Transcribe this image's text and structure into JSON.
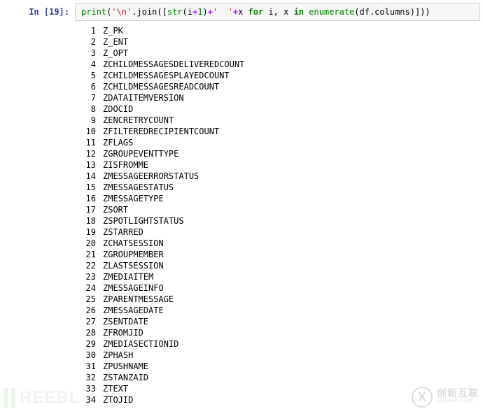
{
  "cell": {
    "prompt_label": "In [",
    "exec_count": "19",
    "prompt_close": "]:",
    "code": {
      "print": "print",
      "lp": "(",
      "str_newline": "'\\n'",
      "dot_join": ".join([",
      "str_fn": "str",
      "lp2": "(i",
      "plus1": "+",
      "one": "1",
      "rp2": ")",
      "plus2": "+",
      "str_space": "'  '",
      "plus3": "+",
      "var_x": "x ",
      "kw_for": "for",
      "iter_vars": " i, x ",
      "kw_in": "in",
      "sp": " ",
      "enumerate": "enumerate",
      "arg": "(df.columns)]))"
    }
  },
  "columns": [
    "Z_PK",
    "Z_ENT",
    "Z_OPT",
    "ZCHILDMESSAGESDELIVEREDCOUNT",
    "ZCHILDMESSAGESPLAYEDCOUNT",
    "ZCHILDMESSAGESREADCOUNT",
    "ZDATAITEMVERSION",
    "ZDOCID",
    "ZENCRETRYCOUNT",
    "ZFILTEREDRECIPIENTCOUNT",
    "ZFLAGS",
    "ZGROUPEVENTTYPE",
    "ZISFROMME",
    "ZMESSAGEERRORSTATUS",
    "ZMESSAGESTATUS",
    "ZMESSAGETYPE",
    "ZSORT",
    "ZSPOTLIGHTSTATUS",
    "ZSTARRED",
    "ZCHATSESSION",
    "ZGROUPMEMBER",
    "ZLASTSESSION",
    "ZMEDIAITEM",
    "ZMESSAGEINFO",
    "ZPARENTMESSAGE",
    "ZMESSAGEDATE",
    "ZSENTDATE",
    "ZFROMJID",
    "ZMEDIASECTIONID",
    "ZPHASH",
    "ZPUSHNAME",
    "ZSTANZAID",
    "ZTEXT",
    "ZTOJID"
  ],
  "watermark_left": "REEBL",
  "watermark_right_cn": "创新互联",
  "watermark_right_en": "CDCXHL.COM"
}
